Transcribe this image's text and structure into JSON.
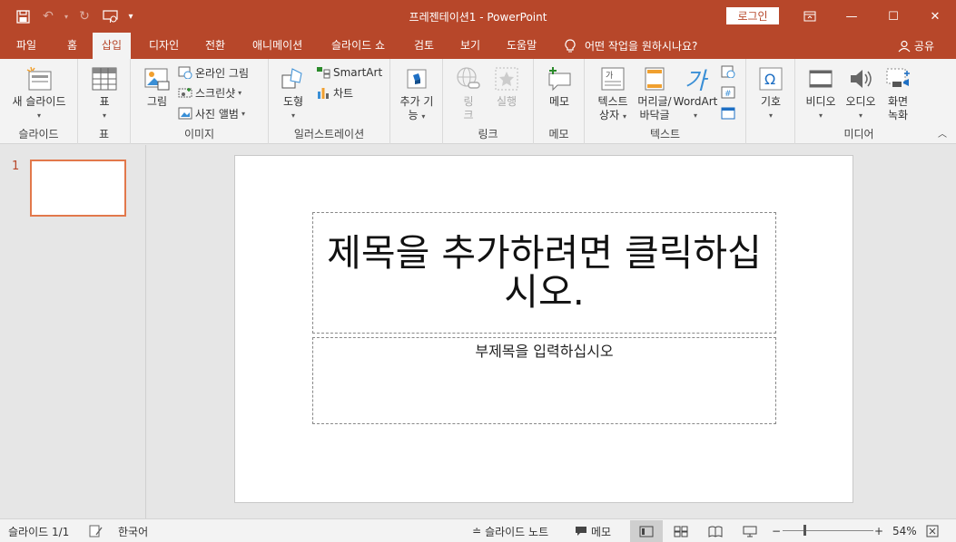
{
  "app": {
    "title": "프레젠테이션1  -  PowerPoint",
    "login_label": "로그인",
    "accent_color": "#b7472a"
  },
  "qat": [
    "save-icon",
    "undo-icon",
    "redo-icon",
    "present-from-start-icon",
    "customize-qat-icon"
  ],
  "tabs": [
    {
      "label": "파일"
    },
    {
      "label": "홈"
    },
    {
      "label": "삽입",
      "active": true
    },
    {
      "label": "디자인"
    },
    {
      "label": "전환"
    },
    {
      "label": "애니메이션"
    },
    {
      "label": "슬라이드 쇼"
    },
    {
      "label": "검토"
    },
    {
      "label": "보기"
    },
    {
      "label": "도움말"
    }
  ],
  "tellme": {
    "placeholder": "어떤 작업을 원하시나요?"
  },
  "share": {
    "label": "공유"
  },
  "ribbon": {
    "new_slide": {
      "label": "새 슬라이드",
      "group": "슬라이드"
    },
    "table": {
      "label": "표",
      "group": "표"
    },
    "images": {
      "picture": "그림",
      "online_picture": "온라인 그림",
      "screenshot": "스크린샷",
      "photo_album": "사진 앨범",
      "group": "이미지"
    },
    "illustrations": {
      "shapes": "도형",
      "smartart": "SmartArt",
      "chart": "차트",
      "group": "일러스트레이션"
    },
    "addins": {
      "label_line1": "추가 기",
      "label_line2": "능"
    },
    "links": {
      "link_line1": "링",
      "link_line2": "크",
      "action": "실행",
      "group": "링크"
    },
    "comments": {
      "label": "메모",
      "group": "메모"
    },
    "text": {
      "textbox_line1": "텍스트",
      "textbox_line2": "상자",
      "header_line1": "머리글/",
      "header_line2": "바닥글",
      "wordart": "WordArt",
      "group": "텍스트"
    },
    "symbols": {
      "label": "기호"
    },
    "media": {
      "video": "비디오",
      "audio": "오디오",
      "screen_line1": "화면",
      "screen_line2": "녹화",
      "group": "미디어"
    }
  },
  "thumbs": [
    {
      "number": "1"
    }
  ],
  "slide": {
    "title_placeholder": "제목을 추가하려면 클릭하십시오.",
    "subtitle_placeholder": "부제목을 입력하십시오"
  },
  "status": {
    "slide_info": "슬라이드 1/1",
    "language": "한국어",
    "notes": "슬라이드 노트",
    "comments": "메모",
    "zoom": "54%",
    "zoom_value": 0.54
  }
}
